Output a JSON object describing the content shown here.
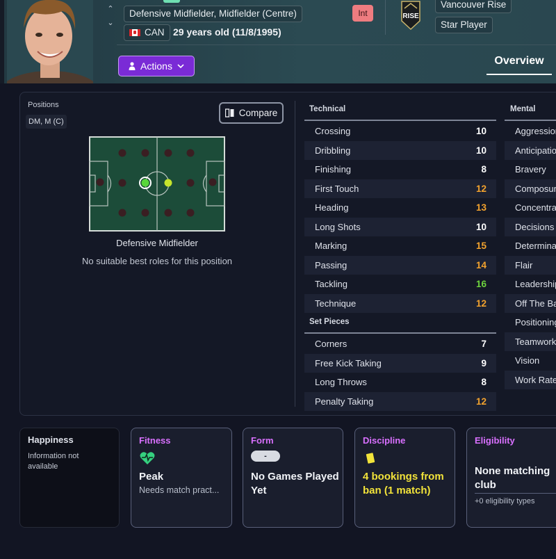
{
  "header": {
    "position_text": "Defensive Midfielder, Midfielder (Centre)",
    "nationality": "CAN",
    "age_text": "29 years old (11/8/1995)",
    "int_badge": "Int",
    "club_name": "Vancouver Rise",
    "club_logo_text": "RISE",
    "status": "Star Player",
    "actions_label": "Actions",
    "overview_tab": "Overview"
  },
  "positions": {
    "label": "Positions",
    "value": "DM, M (C)",
    "compare_label": "Compare",
    "selected_position": "Defensive Midfielder",
    "roles_note": "No suitable best roles for this position"
  },
  "technical": {
    "title": "Technical",
    "attributes": [
      {
        "name": "Crossing",
        "value": "10",
        "tier": "white"
      },
      {
        "name": "Dribbling",
        "value": "10",
        "tier": "white"
      },
      {
        "name": "Finishing",
        "value": "8",
        "tier": "white"
      },
      {
        "name": "First Touch",
        "value": "12",
        "tier": "orange"
      },
      {
        "name": "Heading",
        "value": "13",
        "tier": "orange"
      },
      {
        "name": "Long Shots",
        "value": "10",
        "tier": "white"
      },
      {
        "name": "Marking",
        "value": "15",
        "tier": "orange"
      },
      {
        "name": "Passing",
        "value": "14",
        "tier": "orange"
      },
      {
        "name": "Tackling",
        "value": "16",
        "tier": "green"
      },
      {
        "name": "Technique",
        "value": "12",
        "tier": "orange"
      }
    ]
  },
  "set_pieces": {
    "title": "Set Pieces",
    "attributes": [
      {
        "name": "Corners",
        "value": "7",
        "tier": "white"
      },
      {
        "name": "Free Kick Taking",
        "value": "9",
        "tier": "white"
      },
      {
        "name": "Long Throws",
        "value": "8",
        "tier": "white"
      },
      {
        "name": "Penalty Taking",
        "value": "12",
        "tier": "orange"
      }
    ]
  },
  "mental": {
    "title": "Mental",
    "attributes": [
      "Aggression",
      "Anticipation",
      "Bravery",
      "Composure",
      "Concentration",
      "Decisions",
      "Determination",
      "Flair",
      "Leadership",
      "Off The Ball",
      "Positioning",
      "Teamwork",
      "Vision",
      "Work Rate"
    ]
  },
  "cards": {
    "happiness": {
      "title": "Happiness",
      "text": "Information not available"
    },
    "fitness": {
      "title": "Fitness",
      "value": "Peak",
      "sub": "Needs match pract..."
    },
    "form": {
      "title": "Form",
      "chip": "-",
      "value": "No Games Played Yet"
    },
    "discipline": {
      "title": "Discipline",
      "value": "4 bookings from ban (1 match)"
    },
    "eligibility": {
      "title": "Eligibility",
      "value": "None matching club",
      "sub": "+0 eligibility types"
    }
  },
  "colors": {
    "accent_purple": "#7a2bd6",
    "card_title": "#d970ff",
    "value_orange": "#f2a22e",
    "value_green": "#6ed23e",
    "discipline_yellow": "#f2e33a",
    "fitness_green": "#35d07f"
  }
}
